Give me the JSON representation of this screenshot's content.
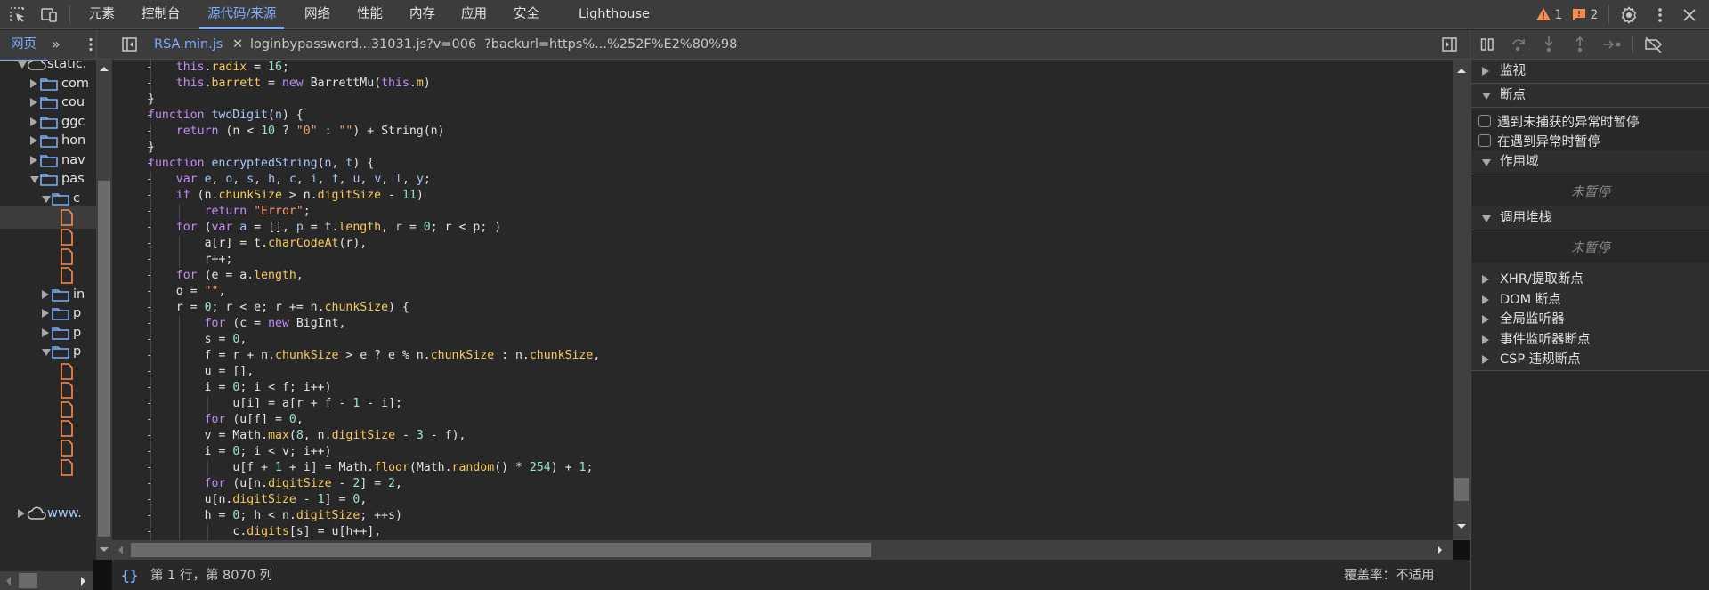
{
  "main_toolbar": {
    "inspect_icon": "inspect-element-icon",
    "device_icon": "device-toolbar-icon",
    "tabs": [
      {
        "label": "元素",
        "active": false
      },
      {
        "label": "控制台",
        "active": false
      },
      {
        "label": "源代码/来源",
        "active": true
      },
      {
        "label": "网络",
        "active": false
      },
      {
        "label": "性能",
        "active": false
      },
      {
        "label": "内存",
        "active": false
      },
      {
        "label": "应用",
        "active": false
      },
      {
        "label": "安全",
        "active": false
      },
      {
        "label": "Lighthouse",
        "active": false
      }
    ],
    "warnings_count": "1",
    "issues_count": "2",
    "accent_color": "#7cacf8",
    "warning_color": "#fc8c4e"
  },
  "sources_toolbar": {
    "navigator_tab": "网页",
    "more_tabs": "»",
    "file_tabs": [
      {
        "label": "RSA.min.js",
        "active": true,
        "closable": true
      },
      {
        "label": "loginbypassword...31031.js?v=006",
        "active": false
      },
      {
        "label": "?backurl=https%...%252F%E2%80%98",
        "active": false
      }
    ]
  },
  "navigator": {
    "items": [
      {
        "label": "static.",
        "type": "domain",
        "expanded": true,
        "depth": 0
      },
      {
        "label": "com",
        "type": "folder",
        "expanded": false,
        "depth": 1
      },
      {
        "label": "cou",
        "type": "folder",
        "expanded": false,
        "depth": 1
      },
      {
        "label": "ggc",
        "type": "folder",
        "expanded": false,
        "depth": 1
      },
      {
        "label": "hon",
        "type": "folder",
        "expanded": false,
        "depth": 1
      },
      {
        "label": "nav",
        "type": "folder",
        "expanded": false,
        "depth": 1
      },
      {
        "label": "pas",
        "type": "folder",
        "expanded": true,
        "depth": 1
      },
      {
        "label": "c",
        "type": "folder",
        "expanded": true,
        "depth": 2
      },
      {
        "label": "",
        "type": "file",
        "depth": 3,
        "selected": true
      },
      {
        "label": "",
        "type": "file",
        "depth": 3
      },
      {
        "label": "",
        "type": "file",
        "depth": 3
      },
      {
        "label": "",
        "type": "file",
        "depth": 3
      },
      {
        "label": "in",
        "type": "folder",
        "expanded": false,
        "depth": 2
      },
      {
        "label": "p",
        "type": "folder",
        "expanded": false,
        "depth": 2
      },
      {
        "label": "p",
        "type": "folder",
        "expanded": false,
        "depth": 2
      },
      {
        "label": "p",
        "type": "folder",
        "expanded": true,
        "depth": 2
      },
      {
        "label": "",
        "type": "file",
        "depth": 3
      },
      {
        "label": "",
        "type": "file",
        "depth": 3
      },
      {
        "label": "",
        "type": "file",
        "depth": 3
      },
      {
        "label": "",
        "type": "file",
        "depth": 3
      },
      {
        "label": "",
        "type": "file",
        "depth": 3
      },
      {
        "label": "",
        "type": "file",
        "depth": 3
      },
      {
        "label": "www.",
        "type": "domain",
        "expanded": false,
        "depth": 0
      }
    ]
  },
  "editor": {
    "gutter_mark": "-",
    "lines": [
      {
        "indent": 2,
        "tokens": [
          [
            "kw",
            "this"
          ],
          [
            "plain",
            "."
          ],
          [
            "prop",
            "radix"
          ],
          [
            "plain",
            " = "
          ],
          [
            "num",
            "16"
          ],
          [
            "plain",
            ";"
          ]
        ]
      },
      {
        "indent": 2,
        "tokens": [
          [
            "kw",
            "this"
          ],
          [
            "plain",
            "."
          ],
          [
            "prop",
            "barrett"
          ],
          [
            "plain",
            " = "
          ],
          [
            "kw",
            "new"
          ],
          [
            "plain",
            " BarrettMu("
          ],
          [
            "kw",
            "this"
          ],
          [
            "plain",
            "."
          ],
          [
            "prop",
            "m"
          ],
          [
            "plain",
            ")"
          ]
        ]
      },
      {
        "indent": 1,
        "tokens": [
          [
            "plain",
            "}"
          ]
        ]
      },
      {
        "indent": 1,
        "tokens": [
          [
            "kw",
            "function"
          ],
          [
            "plain",
            " "
          ],
          [
            "fn",
            "twoDigit"
          ],
          [
            "plain",
            "("
          ],
          [
            "fn",
            "n"
          ],
          [
            "plain",
            ") {"
          ]
        ]
      },
      {
        "indent": 2,
        "tokens": [
          [
            "kw",
            "return"
          ],
          [
            "plain",
            " (n < "
          ],
          [
            "num",
            "10"
          ],
          [
            "plain",
            " ? "
          ],
          [
            "str",
            "\"0\""
          ],
          [
            "plain",
            " : "
          ],
          [
            "str",
            "\"\""
          ],
          [
            "plain",
            ") + String(n)"
          ]
        ]
      },
      {
        "indent": 1,
        "tokens": [
          [
            "plain",
            "}"
          ]
        ]
      },
      {
        "indent": 1,
        "tokens": [
          [
            "kw",
            "function"
          ],
          [
            "plain",
            " "
          ],
          [
            "fn",
            "encryptedString"
          ],
          [
            "plain",
            "("
          ],
          [
            "fn",
            "n"
          ],
          [
            "plain",
            ", "
          ],
          [
            "fn",
            "t"
          ],
          [
            "plain",
            ") {"
          ]
        ]
      },
      {
        "indent": 2,
        "tokens": [
          [
            "kw",
            "var"
          ],
          [
            "plain",
            " "
          ],
          [
            "fn",
            "e"
          ],
          [
            "plain",
            ", "
          ],
          [
            "fn",
            "o"
          ],
          [
            "plain",
            ", "
          ],
          [
            "fn",
            "s"
          ],
          [
            "plain",
            ", "
          ],
          [
            "fn",
            "h"
          ],
          [
            "plain",
            ", "
          ],
          [
            "fn",
            "c"
          ],
          [
            "plain",
            ", "
          ],
          [
            "fn",
            "i"
          ],
          [
            "plain",
            ", "
          ],
          [
            "fn",
            "f"
          ],
          [
            "plain",
            ", "
          ],
          [
            "fn",
            "u"
          ],
          [
            "plain",
            ", "
          ],
          [
            "fn",
            "v"
          ],
          [
            "plain",
            ", "
          ],
          [
            "fn",
            "l"
          ],
          [
            "plain",
            ", "
          ],
          [
            "fn",
            "y"
          ],
          [
            "plain",
            ";"
          ]
        ]
      },
      {
        "indent": 2,
        "tokens": [
          [
            "kw",
            "if"
          ],
          [
            "plain",
            " (n."
          ],
          [
            "prop",
            "chunkSize"
          ],
          [
            "plain",
            " > n."
          ],
          [
            "prop",
            "digitSize"
          ],
          [
            "plain",
            " - "
          ],
          [
            "num",
            "11"
          ],
          [
            "plain",
            ")"
          ]
        ]
      },
      {
        "indent": 3,
        "tokens": [
          [
            "kw",
            "return"
          ],
          [
            "plain",
            " "
          ],
          [
            "str",
            "\"Error\""
          ],
          [
            "plain",
            ";"
          ]
        ]
      },
      {
        "indent": 2,
        "tokens": [
          [
            "kw",
            "for"
          ],
          [
            "plain",
            " ("
          ],
          [
            "kw",
            "var"
          ],
          [
            "plain",
            " "
          ],
          [
            "fn",
            "a"
          ],
          [
            "plain",
            " = [], "
          ],
          [
            "fn",
            "p"
          ],
          [
            "plain",
            " = t."
          ],
          [
            "prop",
            "length"
          ],
          [
            "plain",
            ", "
          ],
          [
            "fn",
            "r"
          ],
          [
            "plain",
            " = "
          ],
          [
            "num",
            "0"
          ],
          [
            "plain",
            "; r < p; )"
          ]
        ]
      },
      {
        "indent": 3,
        "tokens": [
          [
            "plain",
            "a[r] = t."
          ],
          [
            "prop",
            "charCodeAt"
          ],
          [
            "plain",
            "(r),"
          ]
        ]
      },
      {
        "indent": 3,
        "tokens": [
          [
            "plain",
            "r++;"
          ]
        ]
      },
      {
        "indent": 2,
        "tokens": [
          [
            "kw",
            "for"
          ],
          [
            "plain",
            " (e = a."
          ],
          [
            "prop",
            "length"
          ],
          [
            "plain",
            ","
          ]
        ]
      },
      {
        "indent": 2,
        "tokens": [
          [
            "plain",
            "o = "
          ],
          [
            "str",
            "\"\""
          ],
          [
            "plain",
            ","
          ]
        ]
      },
      {
        "indent": 2,
        "tokens": [
          [
            "plain",
            "r = "
          ],
          [
            "num",
            "0"
          ],
          [
            "plain",
            "; r < e; r += n."
          ],
          [
            "prop",
            "chunkSize"
          ],
          [
            "plain",
            ") {"
          ]
        ]
      },
      {
        "indent": 3,
        "tokens": [
          [
            "kw",
            "for"
          ],
          [
            "plain",
            " (c = "
          ],
          [
            "kw",
            "new"
          ],
          [
            "plain",
            " BigInt,"
          ]
        ]
      },
      {
        "indent": 3,
        "tokens": [
          [
            "plain",
            "s = "
          ],
          [
            "num",
            "0"
          ],
          [
            "plain",
            ","
          ]
        ]
      },
      {
        "indent": 3,
        "tokens": [
          [
            "plain",
            "f = r + n."
          ],
          [
            "prop",
            "chunkSize"
          ],
          [
            "plain",
            " > e ? e % n."
          ],
          [
            "prop",
            "chunkSize"
          ],
          [
            "plain",
            " : n."
          ],
          [
            "prop",
            "chunkSize"
          ],
          [
            "plain",
            ","
          ]
        ]
      },
      {
        "indent": 3,
        "tokens": [
          [
            "plain",
            "u = [],"
          ]
        ]
      },
      {
        "indent": 3,
        "tokens": [
          [
            "plain",
            "i = "
          ],
          [
            "num",
            "0"
          ],
          [
            "plain",
            "; i < f; i++)"
          ]
        ]
      },
      {
        "indent": 4,
        "tokens": [
          [
            "plain",
            "u[i] = a[r + f - "
          ],
          [
            "num",
            "1"
          ],
          [
            "plain",
            " - i];"
          ]
        ]
      },
      {
        "indent": 3,
        "tokens": [
          [
            "kw",
            "for"
          ],
          [
            "plain",
            " (u[f] = "
          ],
          [
            "num",
            "0"
          ],
          [
            "plain",
            ","
          ]
        ]
      },
      {
        "indent": 3,
        "tokens": [
          [
            "plain",
            "v = Math."
          ],
          [
            "prop",
            "max"
          ],
          [
            "plain",
            "("
          ],
          [
            "num",
            "8"
          ],
          [
            "plain",
            ", n."
          ],
          [
            "prop",
            "digitSize"
          ],
          [
            "plain",
            " - "
          ],
          [
            "num",
            "3"
          ],
          [
            "plain",
            " - f),"
          ]
        ]
      },
      {
        "indent": 3,
        "tokens": [
          [
            "plain",
            "i = "
          ],
          [
            "num",
            "0"
          ],
          [
            "plain",
            "; i < v; i++)"
          ]
        ]
      },
      {
        "indent": 4,
        "tokens": [
          [
            "plain",
            "u[f + "
          ],
          [
            "num",
            "1"
          ],
          [
            "plain",
            " + i] = Math."
          ],
          [
            "prop",
            "floor"
          ],
          [
            "plain",
            "(Math."
          ],
          [
            "prop",
            "random"
          ],
          [
            "plain",
            "() * "
          ],
          [
            "num",
            "254"
          ],
          [
            "plain",
            ") + "
          ],
          [
            "num",
            "1"
          ],
          [
            "plain",
            ";"
          ]
        ]
      },
      {
        "indent": 3,
        "tokens": [
          [
            "kw",
            "for"
          ],
          [
            "plain",
            " (u[n."
          ],
          [
            "prop",
            "digitSize"
          ],
          [
            "plain",
            " - "
          ],
          [
            "num",
            "2"
          ],
          [
            "plain",
            "] = "
          ],
          [
            "num",
            "2"
          ],
          [
            "plain",
            ","
          ]
        ]
      },
      {
        "indent": 3,
        "tokens": [
          [
            "plain",
            "u[n."
          ],
          [
            "prop",
            "digitSize"
          ],
          [
            "plain",
            " - "
          ],
          [
            "num",
            "1"
          ],
          [
            "plain",
            "] = "
          ],
          [
            "num",
            "0"
          ],
          [
            "plain",
            ","
          ]
        ]
      },
      {
        "indent": 3,
        "tokens": [
          [
            "plain",
            "h = "
          ],
          [
            "num",
            "0"
          ],
          [
            "plain",
            "; h < n."
          ],
          [
            "prop",
            "digitSize"
          ],
          [
            "plain",
            "; ++s)"
          ]
        ]
      },
      {
        "indent": 4,
        "tokens": [
          [
            "plain",
            "c."
          ],
          [
            "prop",
            "digits"
          ],
          [
            "plain",
            "[s] = u[h++],"
          ]
        ]
      }
    ],
    "vertical_scroll_position": 0.95
  },
  "status_bar": {
    "pretty_print_icon": "{}",
    "cursor_position": "第 1 行，第 8070 列",
    "coverage": "覆盖率：不适用"
  },
  "debugger": {
    "sections": [
      {
        "label": "监视",
        "expanded": false
      },
      {
        "label": "断点",
        "expanded": true,
        "checkboxes": [
          {
            "label": "遇到未捕获的异常时暂停",
            "checked": false
          },
          {
            "label": "在遇到异常时暂停",
            "checked": false
          }
        ]
      },
      {
        "label": "作用域",
        "expanded": true,
        "empty_text": "未暂停"
      },
      {
        "label": "调用堆栈",
        "expanded": true,
        "empty_text": "未暂停"
      },
      {
        "label": "XHR/提取断点",
        "expanded": false
      },
      {
        "label": "DOM 断点",
        "expanded": false
      },
      {
        "label": "全局监听器",
        "expanded": false
      },
      {
        "label": "事件监听器断点",
        "expanded": false
      },
      {
        "label": "CSP 违规断点",
        "expanded": false
      }
    ]
  }
}
